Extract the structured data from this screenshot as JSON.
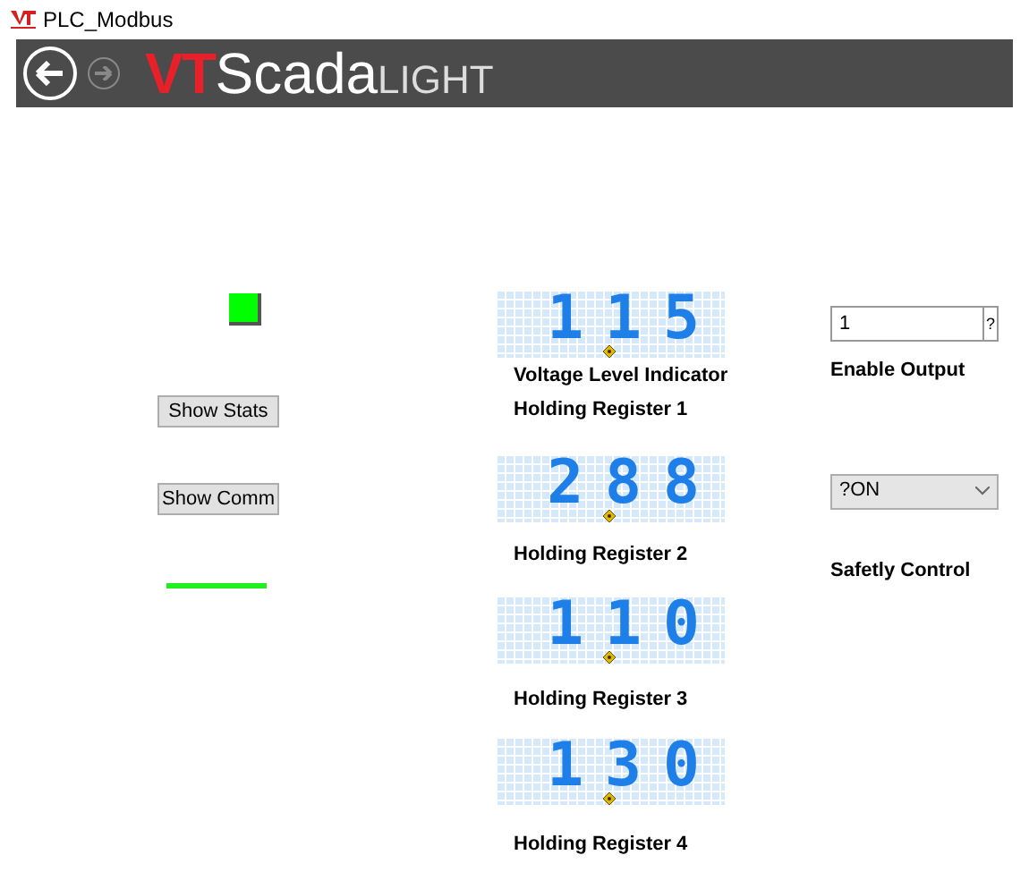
{
  "window": {
    "title": "PLC_Modbus"
  },
  "banner": {
    "logo_prefix": "VT",
    "logo_main": "Scada",
    "logo_suffix": "LIGHT",
    "back_enabled": true,
    "forward_enabled": false
  },
  "status_indicator": {
    "color": "#00ff00"
  },
  "buttons": [
    "Show Stats",
    "Show Comm"
  ],
  "comm_line": {
    "color": "#22ee22"
  },
  "displays": [
    {
      "value": "115",
      "labels": [
        "Voltage Level Indicator",
        "Holding Register 1"
      ]
    },
    {
      "value": "288",
      "labels": [
        "Holding Register 2"
      ]
    },
    {
      "value": "110",
      "labels": [
        "Holding Register 3"
      ]
    },
    {
      "value": "130",
      "labels": [
        "Holding Register 4"
      ]
    }
  ],
  "enable_output": {
    "value": "1",
    "hint": "?",
    "label": "Enable Output"
  },
  "safety_control": {
    "value": "?ON",
    "label": "Safetly Control"
  }
}
